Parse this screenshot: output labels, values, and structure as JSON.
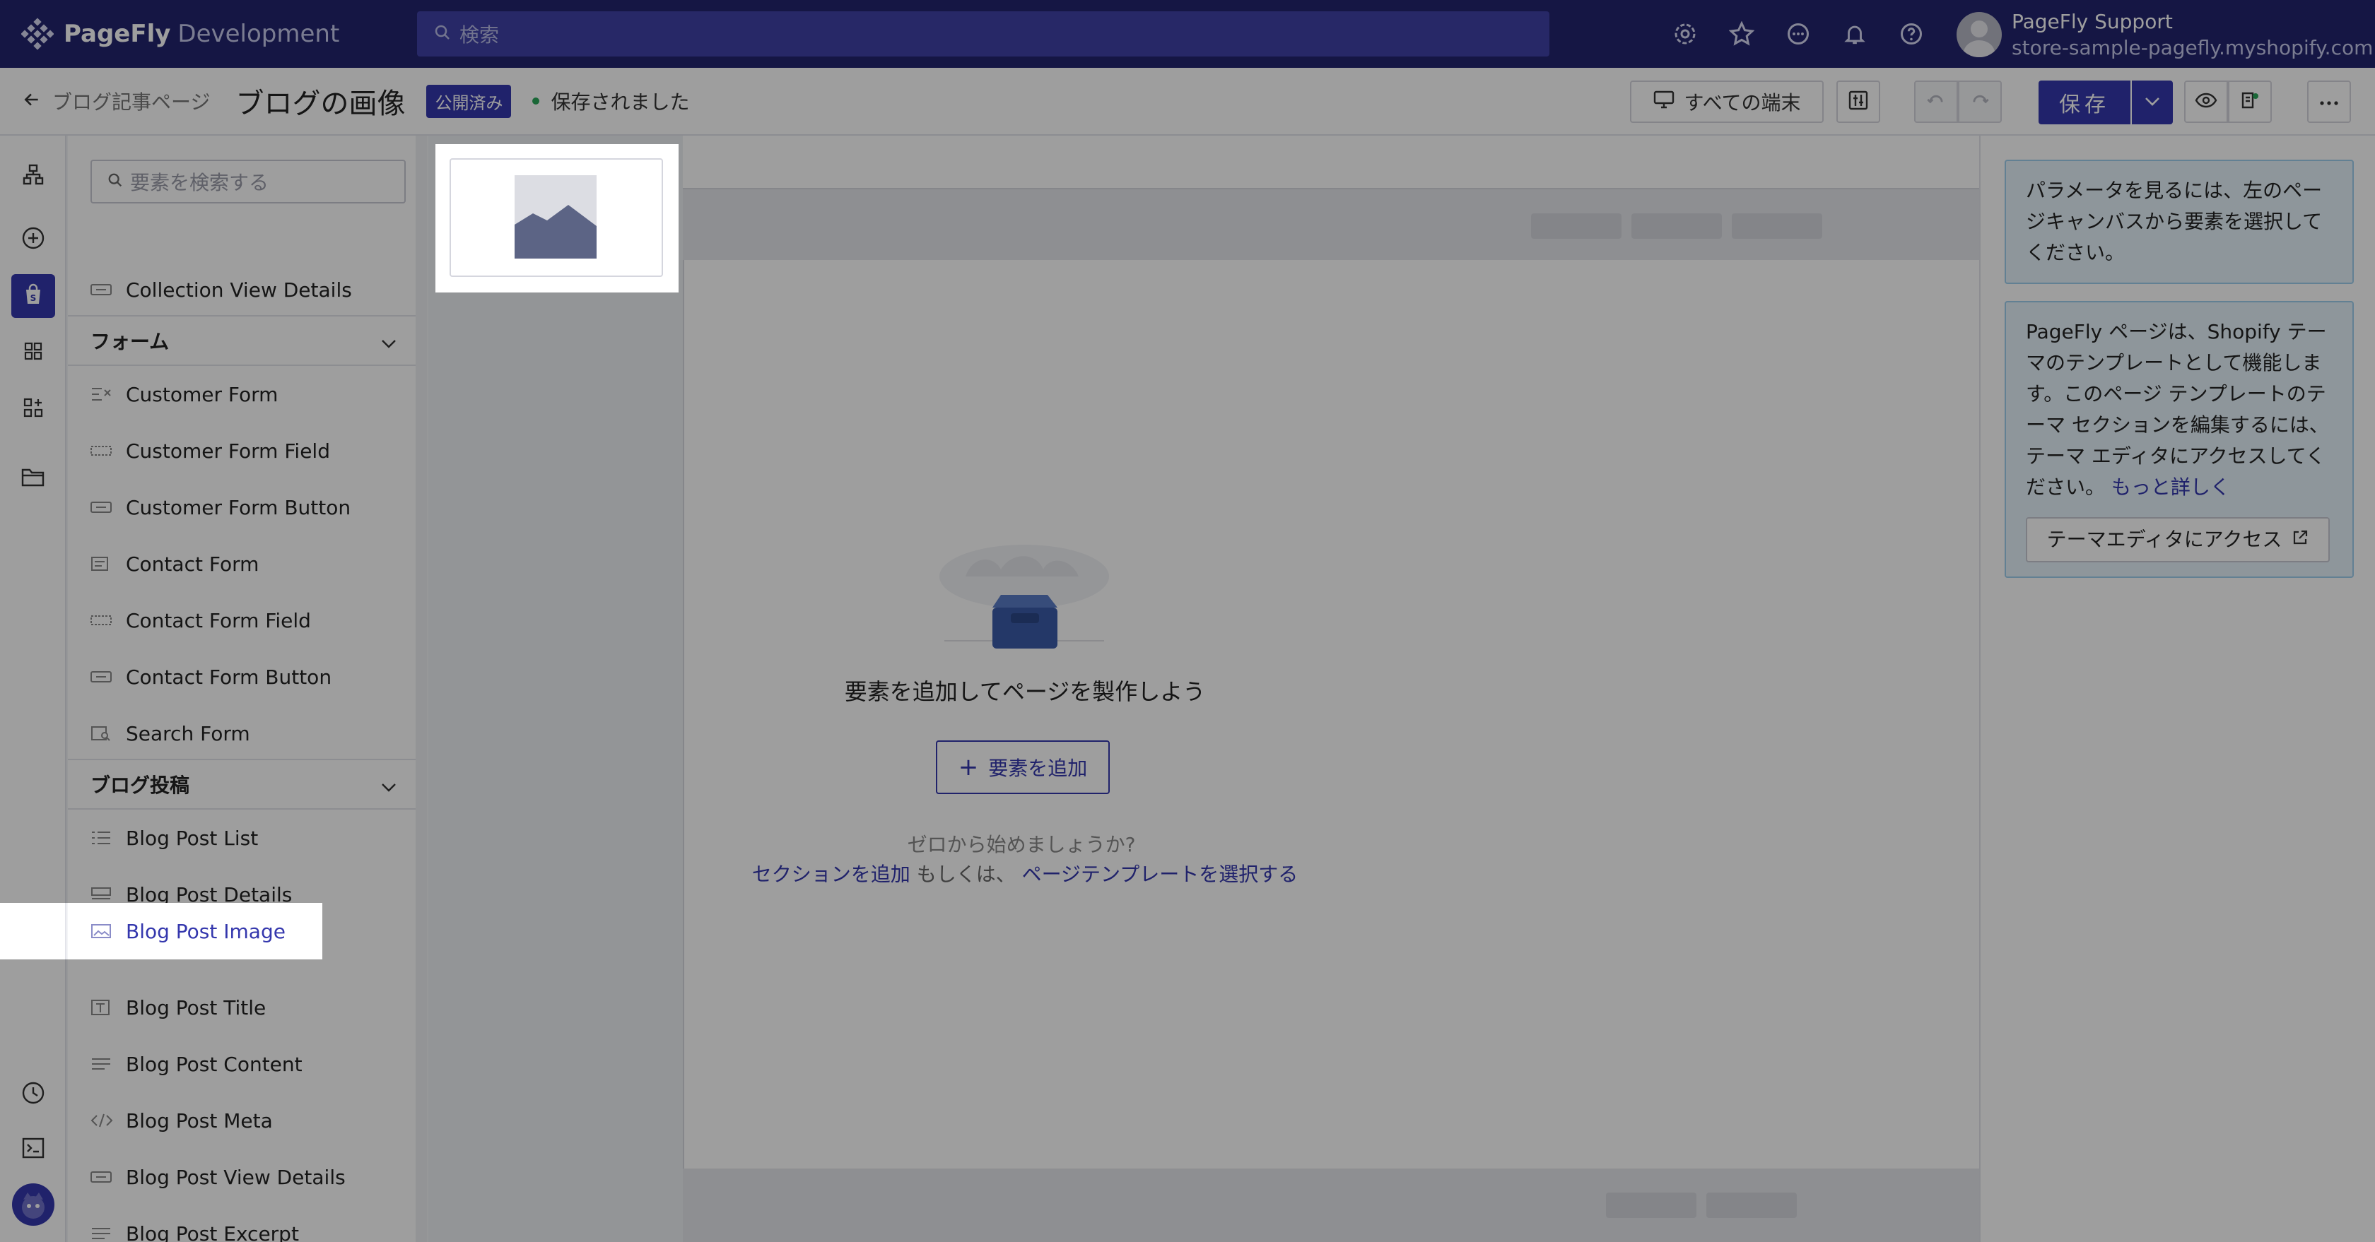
{
  "app": {
    "brand": "PageFly",
    "env": "Development",
    "search_placeholder": "検索",
    "account_name": "PageFly Support",
    "account_store": "store-sample-pagefly.myshopify.com"
  },
  "titlebar": {
    "back_label": "ブログ記事ページ",
    "page_title": "ブログの画像",
    "status_badge": "公開済み",
    "saved_text": "保存されました",
    "devices_label": "すべての端末",
    "save_label": "保存"
  },
  "panel": {
    "search_placeholder": "要素を検索する",
    "top_item": "Collection View Details",
    "sections": [
      {
        "title": "フォーム",
        "items": [
          "Customer Form",
          "Customer Form Field",
          "Customer Form Button",
          "Contact Form",
          "Contact Form Field",
          "Contact Form Button",
          "Search Form"
        ]
      },
      {
        "title": "ブログ投稿",
        "items": [
          "Blog Post List",
          "Blog Post Details",
          "Blog Post Image",
          "Blog Post Title",
          "Blog Post Content",
          "Blog Post Meta",
          "Blog Post View Details",
          "Blog Post Excerpt"
        ]
      }
    ]
  },
  "canvas": {
    "empty_title": "要素を追加してページを製作しよう",
    "add_button": "要素を追加",
    "hint_question": "ゼロから始めましょうか?",
    "hint_add_section": "セクションを追加",
    "hint_or": "もしくは、",
    "hint_select_template": "ページテンプレートを選択する"
  },
  "rightpanel": {
    "info1": "パラメータを見るには、左のページキャンバスから要素を選択してください。",
    "info2": "PageFly ページは、Shopify テーマのテンプレートとして機能します。このページ テンプレートのテーマ セクションを編集するには、テーマ エディタにアクセスしてください。",
    "info2_link": "もっと詳しく",
    "theme_button": "テーマエディタにアクセス"
  },
  "colors": {
    "brand_primary": "#3437ad",
    "topbar_bg": "#23246f",
    "saved_dot": "#2aa75a"
  }
}
